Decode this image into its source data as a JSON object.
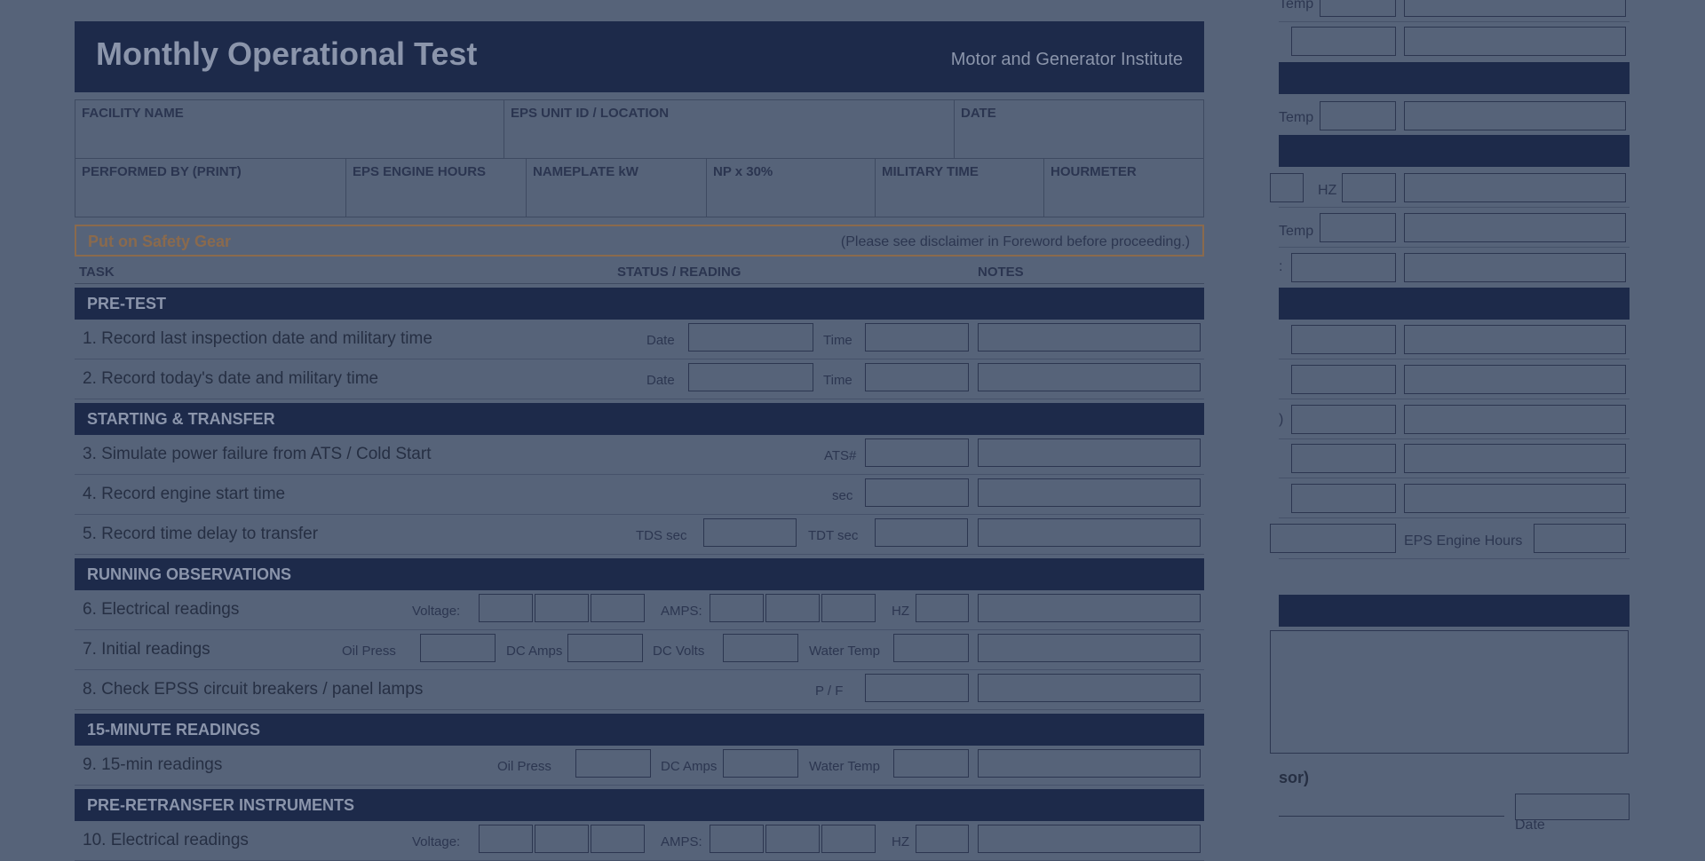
{
  "header": {
    "title": "Monthly Operational Test",
    "org": "Motor and Generator Institute"
  },
  "info": {
    "facility": "FACILITY NAME",
    "unit": "EPS UNIT ID / LOCATION",
    "date": "DATE",
    "performed_by": "PERFORMED BY (PRINT)",
    "engine_hours": "EPS ENGINE HOURS",
    "nameplate": "NAMEPLATE kW",
    "np30": "NP x 30%",
    "military": "MILITARY TIME",
    "hourmeter": "HOURMETER"
  },
  "safety": {
    "label": "Put on Safety Gear",
    "note": "(Please see disclaimer in Foreword before proceeding.)"
  },
  "columns": {
    "task": "TASK",
    "status": "STATUS / READING",
    "notes": "NOTES"
  },
  "sections": {
    "pretest": "PRE-TEST",
    "starting": "STARTING & TRANSFER",
    "running": "RUNNING OBSERVATIONS",
    "fifteen": "15-MINUTE READINGS",
    "preretransfer": "PRE-RETRANSFER INSTRUMENTS"
  },
  "tasks": {
    "t1": "1. Record last inspection date and military time",
    "t2": "2. Record today's date and military time",
    "t3": "3. Simulate power failure from ATS / Cold Start",
    "t4": "4. Record engine start time",
    "t5": "5. Record time delay to transfer",
    "t6": "6. Electrical readings",
    "t7": "7. Initial readings",
    "t8": "8. Check EPSS circuit breakers / panel lamps",
    "t9": "9. 15-min readings",
    "t10": "10. Electrical readings"
  },
  "labels": {
    "date": "Date",
    "time": "Time",
    "ats": "ATS#",
    "sec": "sec",
    "tds": "TDS sec",
    "tdt": "TDT sec",
    "voltage": "Voltage:",
    "amps": "AMPS:",
    "hz": "HZ",
    "oil_press": "Oil Press",
    "dc_amps": "DC Amps",
    "dc_volts": "DC Volts",
    "water_temp": "Water Temp",
    "pf": "P / F"
  },
  "right_page": {
    "temp1": "Temp",
    "temp2": "Temp",
    "hz": "HZ",
    "temp3": "Temp",
    "colon": ":",
    "paren": ")",
    "eps_hours": "EPS Engine Hours",
    "sor": "sor)",
    "date": "Date"
  }
}
